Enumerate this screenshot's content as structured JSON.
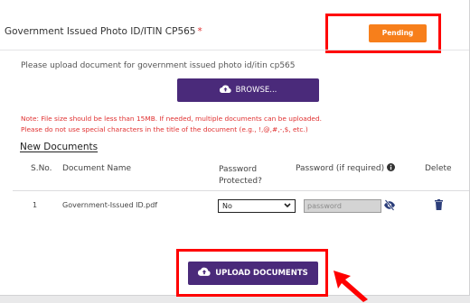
{
  "document": {
    "title": "Government Issued Photo ID/ITIN CP565",
    "required_mark": "*",
    "status": "Pending",
    "instruction": "Please upload document for government issued photo id/itin cp565"
  },
  "browse_button": {
    "label": "BROWSE...",
    "icon": "cloud-upload-icon"
  },
  "notes": {
    "line1": "Note: File size should be less than 15MB. If needed, multiple documents can be uploaded.",
    "line2": "Please do not use special characters in the title of the document (e.g., !,@,#,-,$, etc.)"
  },
  "new_documents": {
    "section_title": "New Documents",
    "columns": {
      "sno": "S.No.",
      "name": "Document Name",
      "password_protected": "Password Protected?",
      "password": "Password (if required)",
      "delete": "Delete"
    },
    "rows": [
      {
        "sno": "1",
        "name": "Government-Issued ID.pdf",
        "password_protected": "No",
        "password_placeholder": "password"
      }
    ]
  },
  "upload_button": {
    "label": "UPLOAD DOCUMENTS",
    "icon": "cloud-upload-icon"
  },
  "colors": {
    "primary": "#4a2a7a",
    "pending": "#f77f1b",
    "warning_text": "#e03131",
    "highlight": "#ff0000"
  }
}
